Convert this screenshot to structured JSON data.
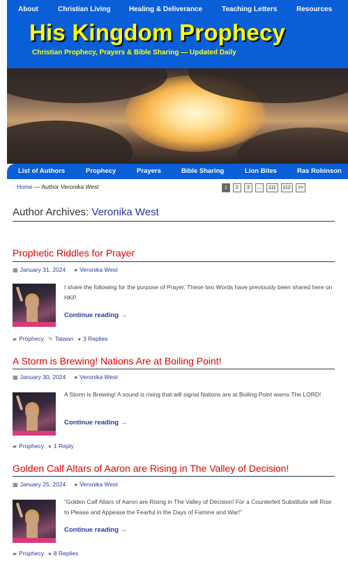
{
  "top_nav": [
    "About",
    "Christian Living",
    "Healing & Deliverance",
    "Teaching Letters",
    "Resources"
  ],
  "site": {
    "title": "His Kingdom Prophecy",
    "tagline": "Christian Prophecy, Prayers & Bible Sharing — Updated Daily"
  },
  "sub_nav": [
    "List of Authors",
    "Prophecy",
    "Prayers",
    "Bible Sharing",
    "Lion Bites",
    "Ras Robinson"
  ],
  "breadcrumb": {
    "home": "Home",
    "sep": " — ",
    "prefix": "Author ",
    "author": "Veronika West"
  },
  "pagination": [
    "1",
    "2",
    "3",
    "...",
    "111",
    "112",
    ">>"
  ],
  "archive": {
    "label": "Author Archives: ",
    "author": "Veronika West"
  },
  "posts": [
    {
      "title": "Prophetic Riddles for Prayer",
      "date": "January 31, 2024",
      "author": "Veronika West",
      "excerpt": "I share the following for the purpose of Prayer.  These two Words have previously been shared here on HKP.",
      "more": "Continue reading →",
      "category": "Prophecy",
      "tag": "Taiwan",
      "replies": "3 Replies"
    },
    {
      "title": "A Storm is Brewing! Nations Are at Boiling Point!",
      "date": "January 30, 2024",
      "author": "Veronika West",
      "excerpt": "A Storm is Brewing! A sound is rising that will signal Nations are at Boiling Point warns The LORD!",
      "more": "Continue reading →",
      "category": "Prophecy",
      "replies": "1 Reply"
    },
    {
      "title": "Golden Calf Altars of Aaron are Rising in The Valley of Decision!",
      "date": "January 25, 2024",
      "author": "Veronika West",
      "excerpt": "“Golden Calf Altars of Aaron are Rising in The Valley of Decision! For a Counterfeit Substitute will Rise to Please and Appease the Fearful in the Days of Famine and War!”",
      "more": "Continue reading →",
      "category": "Prophecy",
      "replies": "8 Replies"
    }
  ],
  "icons": {
    "date": "calendar-icon",
    "author": "person-icon",
    "category": "folder-icon",
    "tag": "tag-icon",
    "comments": "comment-icon"
  },
  "colors": {
    "brand_blue": "#0a5ed7",
    "title_yellow": "#ffff00",
    "post_title_red": "#e00000",
    "link_blue": "#2a3b9a"
  }
}
